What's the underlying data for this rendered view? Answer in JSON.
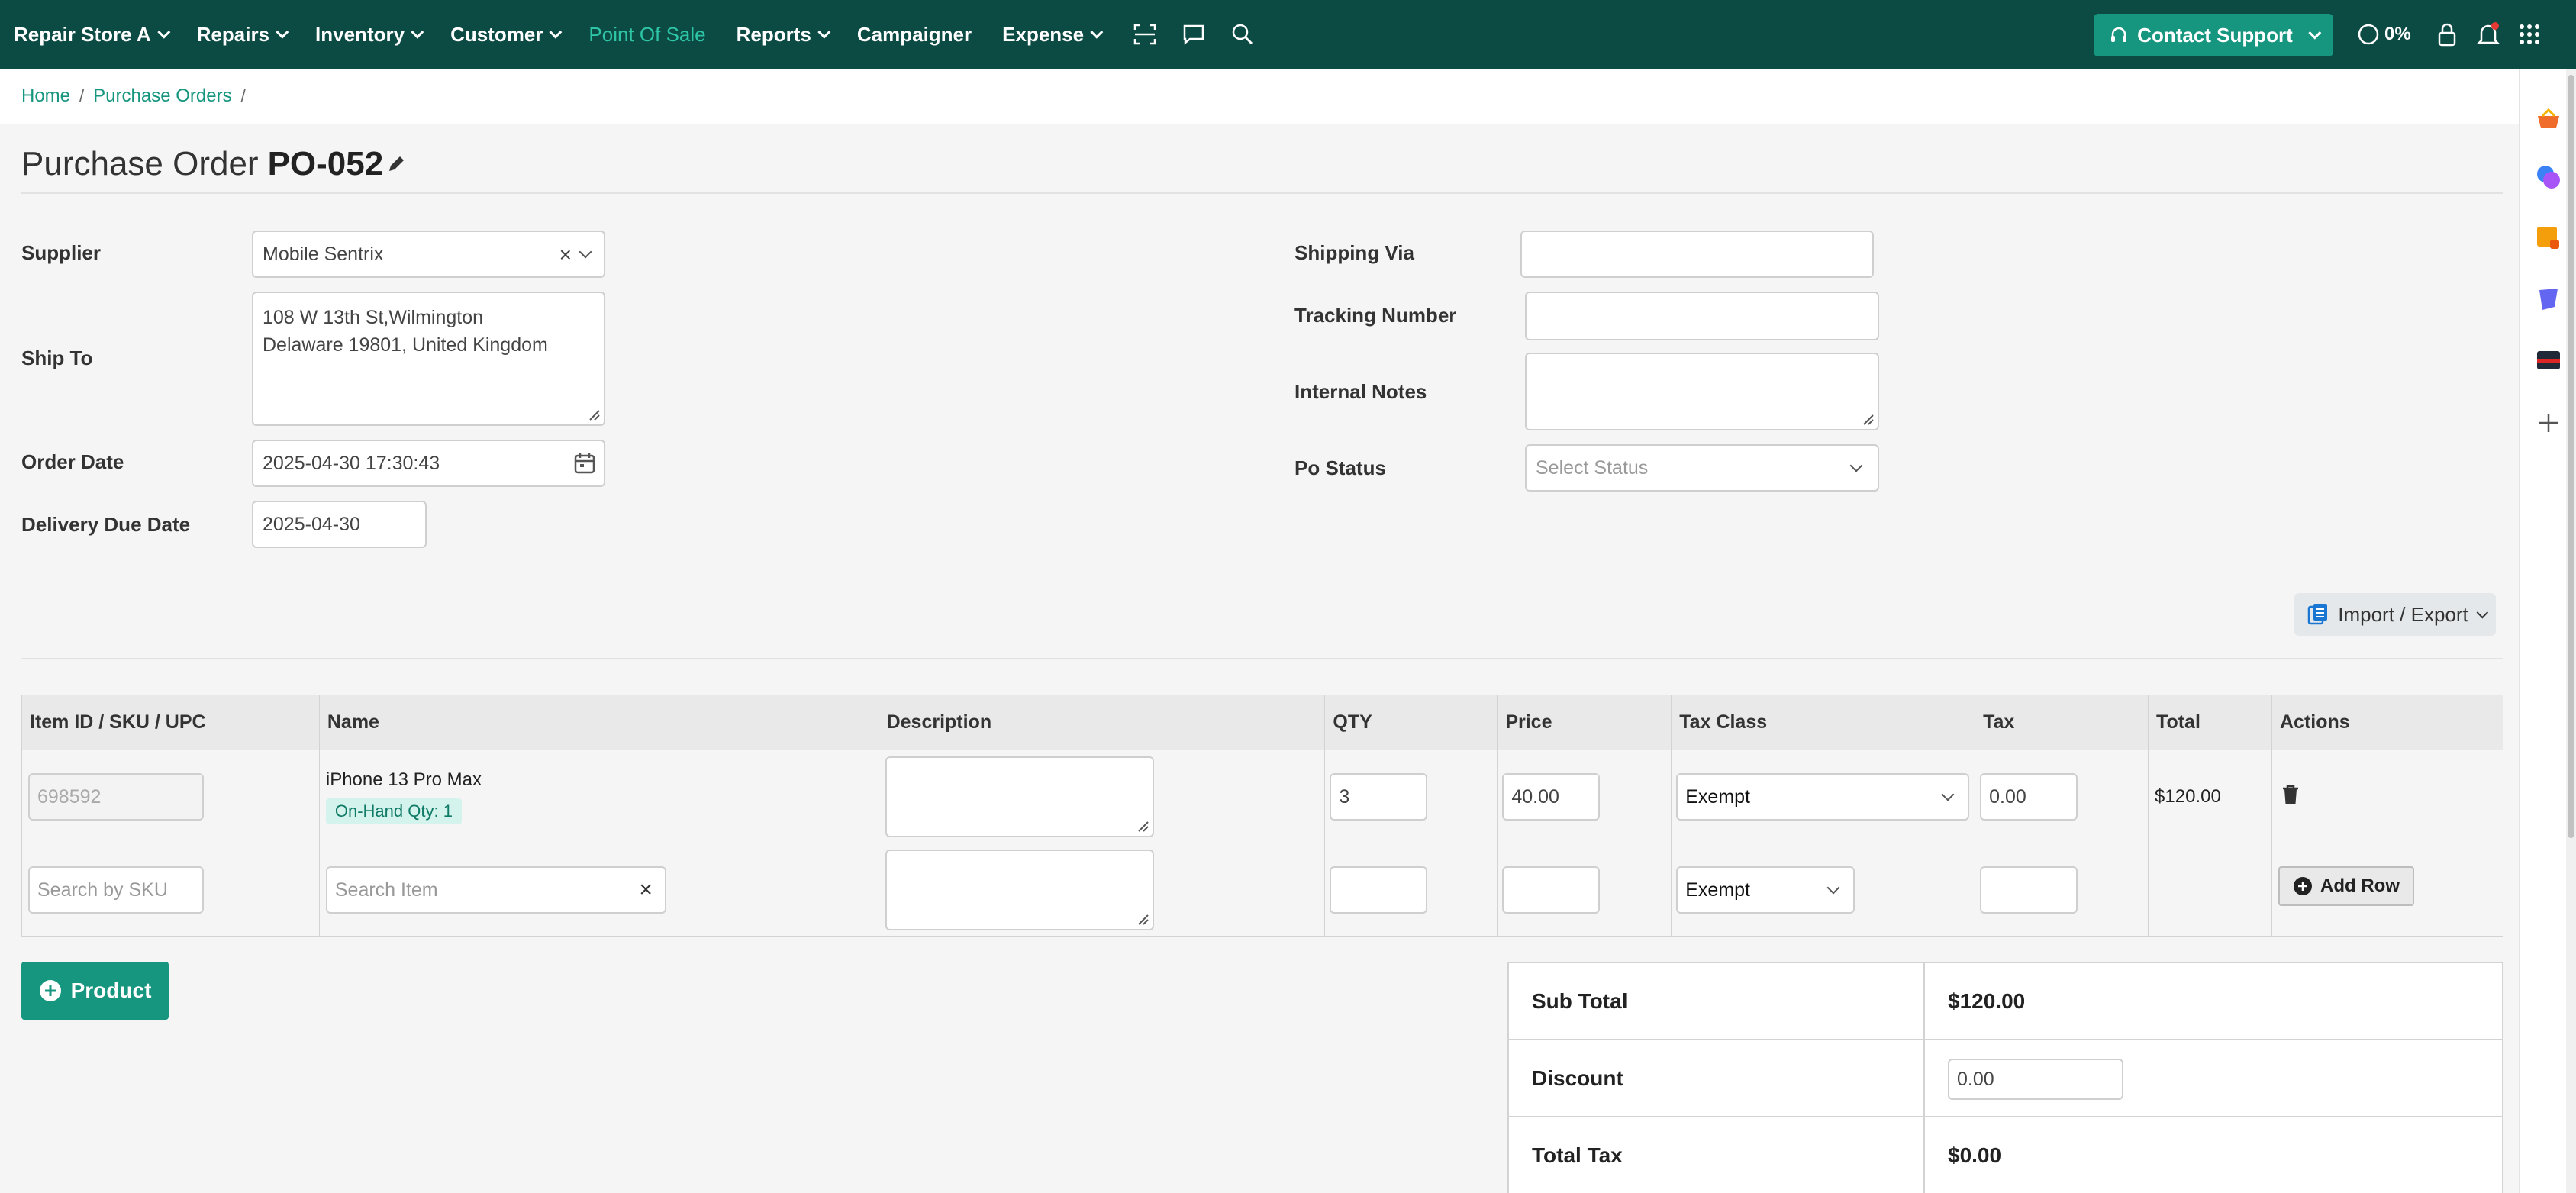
{
  "nav": {
    "store": "Repair Store A",
    "items": [
      "Repairs",
      "Inventory",
      "Customer",
      "Point Of Sale",
      "Reports",
      "Campaigner",
      "Expense"
    ],
    "support": "Contact Support",
    "progress": "0%"
  },
  "breadcrumb": {
    "home": "Home",
    "purchase_orders": "Purchase Orders",
    "sep": "/"
  },
  "page": {
    "title": "Purchase Order",
    "po_number": "PO-052"
  },
  "form": {
    "supplier_label": "Supplier",
    "supplier_value": "Mobile Sentrix",
    "ship_to_label": "Ship To",
    "ship_to_line1": "108 W 13th St,Wilmington",
    "ship_to_line2": "Delaware 19801, United Kingdom",
    "order_date_label": "Order Date",
    "order_date_value": "2025-04-30 17:30:43",
    "delivery_label": "Delivery Due Date",
    "delivery_value": "2025-04-30",
    "shipping_via_label": "Shipping Via",
    "tracking_label": "Tracking Number",
    "notes_label": "Internal Notes",
    "status_label": "Po Status",
    "status_placeholder": "Select Status"
  },
  "import_export": "Import / Export",
  "table": {
    "headers": [
      "Item ID / SKU / UPC",
      "Name",
      "Description",
      "QTY",
      "Price",
      "Tax Class",
      "Tax",
      "Total",
      "Actions"
    ],
    "row1": {
      "sku": "698592",
      "name": "iPhone 13 Pro Max",
      "badge": "On-Hand Qty: 1",
      "qty": "3",
      "price": "40.00",
      "tax_class": "Exempt",
      "tax": "0.00",
      "total": "$120.00"
    },
    "row2": {
      "sku_placeholder": "Search by SKU",
      "item_placeholder": "Search Item",
      "tax_class": "Exempt",
      "add_row": "Add Row"
    }
  },
  "product_btn": "Product",
  "totals": {
    "subtotal_label": "Sub Total",
    "subtotal": "$120.00",
    "discount_label": "Discount",
    "discount": "0.00",
    "tax_label": "Total Tax",
    "tax": "$0.00"
  }
}
